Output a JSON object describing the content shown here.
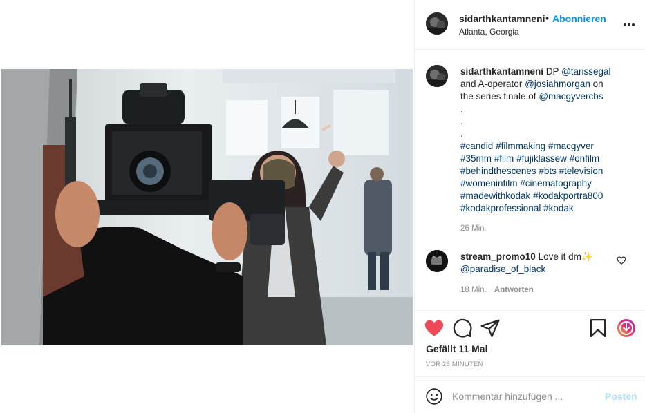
{
  "post": {
    "username": "sidarthkantamneni",
    "follow_label": "Abonnieren",
    "separator": "•",
    "location": "Atlanta, Georgia"
  },
  "caption": {
    "username": "sidarthkantamneni",
    "segments": [
      {
        "text": "DP ",
        "link": false
      },
      {
        "text": "@tarissegal",
        "link": true
      },
      {
        "text": " and A-operator ",
        "link": false
      },
      {
        "text": "@josiahmorgan",
        "link": true
      },
      {
        "text": " on the series finale of ",
        "link": false
      },
      {
        "text": "@macgyvercbs",
        "link": true
      }
    ],
    "dots": [
      ".",
      ".",
      "."
    ],
    "hashtags": [
      "#candid",
      "#filmmaking",
      "#macgyver",
      "#35mm",
      "#film",
      "#fujiklassew",
      "#onfilm",
      "#behindthescenes",
      "#bts",
      "#television",
      "#womeninfilm",
      "#cinematography",
      "#madewithkodak",
      "#kodakportra800",
      "#kodakprofessional",
      "#kodak"
    ],
    "time": "26 Min."
  },
  "comment": {
    "username": "stream_promo10",
    "text": "Love it dm✨",
    "mention": "@paradise_of_black",
    "time": "18 Min.",
    "reply_label": "Antworten"
  },
  "actions": {
    "likes": "Gefällt 11 Mal",
    "posted_ago": "VOR 26 MINUTEN",
    "icons": [
      "heart-icon-liked",
      "comment-icon",
      "share-icon",
      "save-icon",
      "download-icon"
    ],
    "like_color": "#ed4956"
  },
  "add_comment": {
    "placeholder": "Kommentar hinzufügen ...",
    "post_label": "Posten"
  },
  "colors": {
    "link": "#00376b",
    "accent": "#0095f6",
    "muted": "#8e8e8e"
  }
}
